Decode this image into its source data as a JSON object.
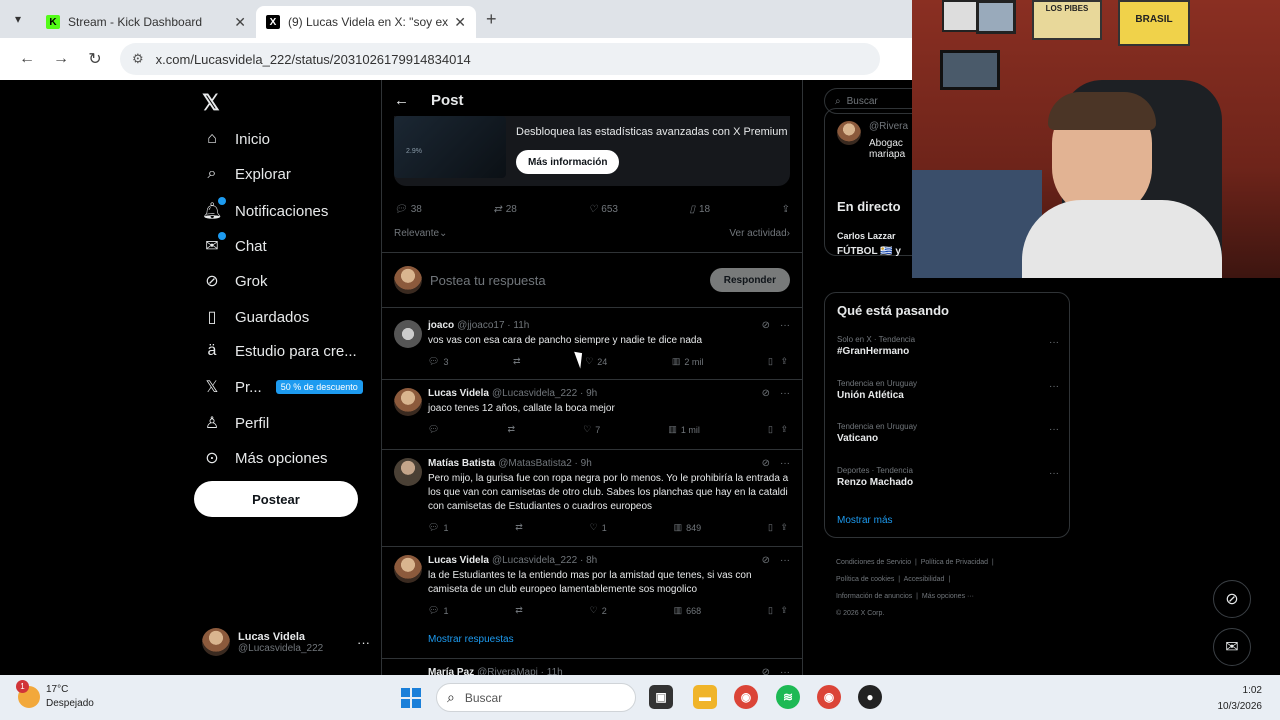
{
  "browser": {
    "tabs": [
      {
        "title": "Stream - Kick Dashboard",
        "favicon": "K",
        "color": "#53fc18"
      },
      {
        "title": "(9) Lucas Videla en X: \"soy extre",
        "favicon": "X",
        "color": "#000000"
      }
    ],
    "url": "x.com/Lucasvidela_222/status/2031026179914834014"
  },
  "nav": {
    "items": [
      {
        "label": "Inicio",
        "icon": "home-icon"
      },
      {
        "label": "Explorar",
        "icon": "search-icon"
      },
      {
        "label": "Notificaciones",
        "icon": "bell-icon"
      },
      {
        "label": "Chat",
        "icon": "mail-icon"
      },
      {
        "label": "Grok",
        "icon": "grok-icon"
      },
      {
        "label": "Guardados",
        "icon": "bookmark-icon"
      },
      {
        "label": "Estudio para cre...",
        "icon": "creator-studio-icon"
      },
      {
        "label": "Pr...",
        "icon": "x-premium-icon",
        "badge": "50 % de descuento"
      },
      {
        "label": "Perfil",
        "icon": "person-icon"
      },
      {
        "label": "Más opciones",
        "icon": "more-circle-icon"
      }
    ],
    "post_button": "Postear",
    "account": {
      "name": "Lucas Videla",
      "handle": "@Lucasvidela_222"
    }
  },
  "main": {
    "title": "Post",
    "promo": {
      "text": "Desbloquea las estadísticas avanzadas con X Premium",
      "button": "Más información",
      "thumb_label": "2.9%"
    },
    "stats": {
      "replies": "38",
      "reposts": "28",
      "likes": "653",
      "bookmarks": "18"
    },
    "sort": {
      "left": "Relevante",
      "right": "Ver actividad"
    },
    "reply": {
      "placeholder": "Postea tu respuesta",
      "button": "Responder"
    },
    "tweets": [
      {
        "name": "joaco",
        "handle": "@jjoaco17 · 11h",
        "text": "vos vas con esa cara de pancho siempre y nadie te dice nada",
        "replies": "3",
        "reposts": "",
        "likes": "24",
        "views": "2 mil"
      },
      {
        "name": "Lucas Videla",
        "handle": "@Lucasvidela_222 · 9h",
        "text": "joaco tenes 12 años, callate la boca mejor",
        "replies": "",
        "reposts": "",
        "likes": "7",
        "views": "1 mil"
      },
      {
        "name": "Matías Batista",
        "handle": "@MatasBatista2 · 9h",
        "text": "Pero mijo, la gurisa fue con ropa negra por lo menos. Yo le prohibiría la entrada a los que van con camisetas de otro club. Sabes los planchas que hay en la cataldi con camisetas de  Estudiantes o cuadros europeos",
        "replies": "1",
        "reposts": "",
        "likes": "1",
        "views": "849"
      },
      {
        "name": "Lucas Videla",
        "handle": "@Lucasvidela_222 · 8h",
        "text": "la de Estudiantes te la entiendo mas por la amistad que tenes, si vas con camiseta de un club europeo lamentablemente sos mogolico",
        "replies": "1",
        "reposts": "",
        "likes": "2",
        "views": "668"
      },
      {
        "name": "María Paz",
        "handle": "@RiveraMapi · 11h",
        "text": "",
        "replies": "",
        "reposts": "",
        "likes": "",
        "views": ""
      }
    ],
    "show_replies": "Mostrar respuestas"
  },
  "right": {
    "search_placeholder": "Buscar",
    "live": {
      "title": "En directo",
      "snippet_user": "@Rivera",
      "snippet_1": "Abogac",
      "snippet_2": "mariapa",
      "line1": "Carlos Lazzar",
      "line2": "FÚTBOL 🇺🇾 y"
    },
    "trends_title": "Qué está pasando",
    "trends": [
      {
        "meta": "Solo en X · Tendencia",
        "name": "#GranHermano"
      },
      {
        "meta": "Tendencia en Uruguay",
        "name": "Unión Atlética"
      },
      {
        "meta": "Tendencia en Uruguay",
        "name": "Vaticano"
      },
      {
        "meta": "Deportes · Tendencia",
        "name": "Renzo Machado"
      }
    ],
    "show_more": "Mostrar más",
    "footer": [
      "Condiciones de Servicio",
      "Política de Privacidad",
      "Política de cookies",
      "Accesibilidad",
      "Información de anuncios",
      "Más opciones ···",
      "© 2026 X Corp."
    ]
  },
  "webcam": {
    "poster_text": "LOS PIBES",
    "flag_text": "BRASIL"
  },
  "taskbar": {
    "weather_temp": "17°C",
    "weather_desc": "Despejado",
    "weather_badge": "1",
    "search_placeholder": "Buscar",
    "time": "1:02",
    "date": "10/3/2026"
  }
}
